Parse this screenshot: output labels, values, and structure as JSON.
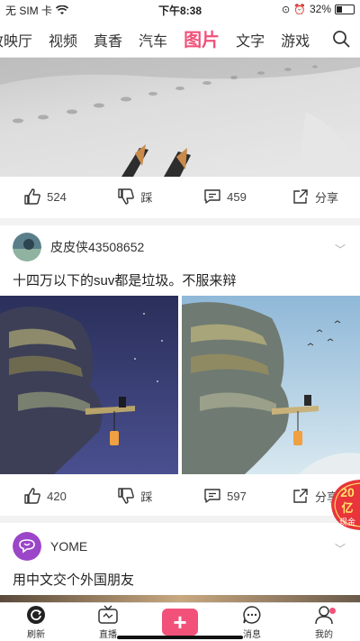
{
  "status_bar": {
    "carrier": "无 SIM 卡",
    "time": "下午8:38",
    "battery_text": "32%",
    "battery_level": 0.32
  },
  "tabs": [
    "放映厅",
    "视频",
    "真香",
    "汽车",
    "图片",
    "文字",
    "游戏"
  ],
  "active_tab": "图片",
  "feed": {
    "card1": {
      "likes": "524",
      "dislike_label": "踩",
      "comments": "459",
      "share_label": "分享"
    },
    "card2": {
      "username": "皮皮侠43508652",
      "caption": "十四万以下的suv都是垃圾。不服来辩",
      "likes": "420",
      "dislike_label": "踩",
      "comments": "597",
      "share_label": "分享"
    },
    "card3": {
      "username": "YOME",
      "caption": "用中文交个外国朋友"
    }
  },
  "promo_badge": {
    "line1": "20",
    "line2": "亿",
    "line3": "现金"
  },
  "bottom_nav": {
    "refresh": "刷新",
    "live": "直播",
    "messages": "消息",
    "me": "我的"
  },
  "colors": {
    "accent": "#f2527a",
    "text": "#222222"
  },
  "icons": [
    "wifi-icon",
    "search-icon",
    "thumb-up-icon",
    "thumb-down-icon",
    "comment-icon",
    "share-icon",
    "refresh-icon",
    "live-icon",
    "plus-icon",
    "message-icon",
    "user-icon"
  ]
}
